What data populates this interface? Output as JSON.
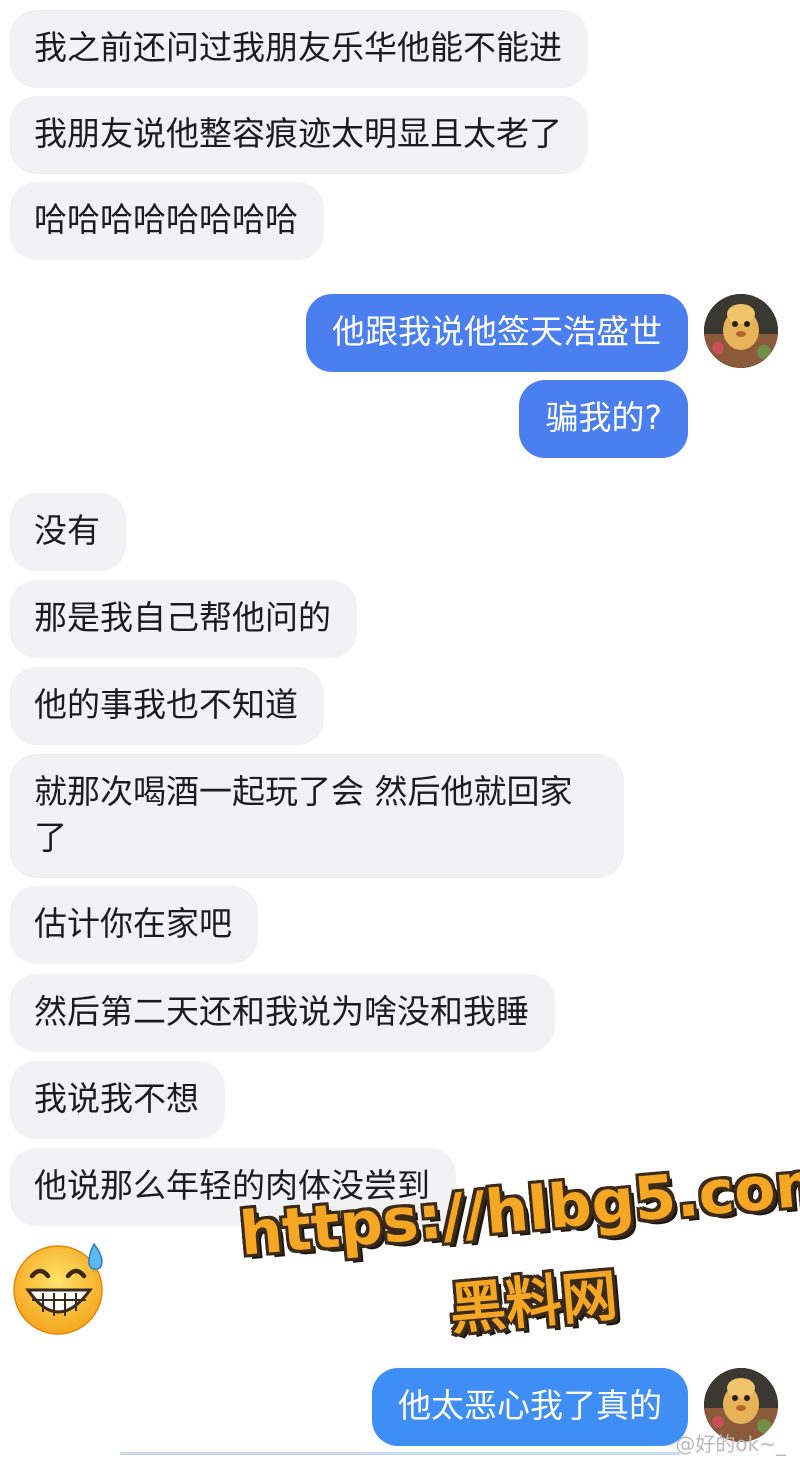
{
  "messages": [
    {
      "text": "我之前还问过我朋友乐华他能不能进"
    },
    {
      "text": "我朋友说他整容痕迹太明显且太老了"
    },
    {
      "text": "哈哈哈哈哈哈哈哈"
    },
    {
      "text": "他跟我说他签天浩盛世"
    },
    {
      "text": "骗我的?"
    },
    {
      "text": "没有"
    },
    {
      "text": "那是我自己帮他问的"
    },
    {
      "text": "他的事我也不知道"
    },
    {
      "text": "就那次喝酒一起玩了会 然后他就回家了"
    },
    {
      "text": "估计你在家吧"
    },
    {
      "text": "然后第二天还和我说为啥没和我睡"
    },
    {
      "text": "我说我不想"
    },
    {
      "text": "他说那么年轻的肉体没尝到"
    },
    {
      "text": "他太恶心我了真的"
    }
  ],
  "emoji_icon": "grinning-sweat-emoji",
  "watermark": {
    "url": "https://hlbg5.com",
    "site_name": "黑料网"
  },
  "credit": "@好的ok~_",
  "colors": {
    "incoming_bubble": "#f2f2f4",
    "outgoing_bubble": "#4b7ff0",
    "watermark": "#f5a623"
  }
}
